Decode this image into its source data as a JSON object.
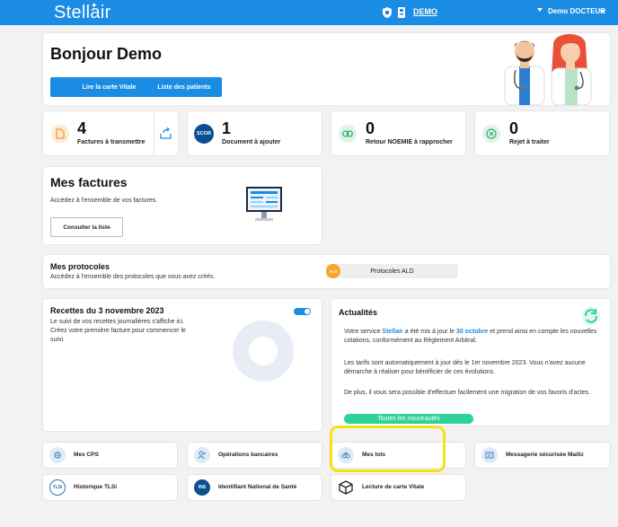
{
  "topbar": {
    "logo": "Stellair",
    "workspace": "DEMO",
    "user": "Demo DOCTEUR"
  },
  "welcome": {
    "greeting": "Bonjour Demo",
    "vitale_button": "Lire la carte Vitale",
    "patients_button": "Liste des patients"
  },
  "stats": [
    {
      "value": "4",
      "label": "Factures à transmettre",
      "icon": "document-icon"
    },
    {
      "value": "1",
      "label": "Document à ajouter",
      "icon": "scor-icon",
      "icon_text": "SCOR"
    },
    {
      "value": "0",
      "label": "Retour NOEMIE à rapprocher",
      "icon": "link-icon"
    },
    {
      "value": "0",
      "label": "Rejet à traiter",
      "icon": "close-circle-icon"
    }
  ],
  "factures": {
    "title": "Mes factures",
    "description": "Accédez à l'ensemble de vos factures.",
    "button": "Consulter la liste"
  },
  "protocoles": {
    "title": "Mes protocoles",
    "description": "Accédez à l'ensemble des protocoles que vous avez créés.",
    "button": "Protocoles ALD",
    "badge": "ALD"
  },
  "recettes": {
    "title": "Recettes du 3 novembre 2023",
    "text": "Le suivi de vos recettes journalières s'affiche ici. Créez votre première facture pour commencer le suivi.",
    "toggle_on": true
  },
  "actualites": {
    "title": "Actualités",
    "para1_before": "Votre service ",
    "para1_brand": "Stellair",
    "para1_mid": " a été mis à jour le ",
    "para1_date": "30 octobre",
    "para1_after": " et prend ainsi en compte les nouvelles cotations, conformément au Règlement Arbitral.",
    "para2": "Les tarifs sont automatiquement à jour dès le 1er novembre 2023. Vous n'avez aucune démarche à réaliser pour bénéficier de ces évolutions.",
    "para3": "De plus, il vous sera possible d'effectuer facilement une migration de vos favoris d'actes.",
    "button": "Toutes les nouveautés"
  },
  "tiles": {
    "mes_cps": "Mes CPS",
    "operations": "Opérations bancaires",
    "mes_lots": "Mes lots",
    "messagerie": "Messagerie sécurisée Mailiz",
    "historique": "Historique TLSi",
    "historique_badge": "TLSi",
    "ins": "Identifiant National de Santé",
    "ins_badge": "INS",
    "lecture": "Lecture de carte Vitale"
  },
  "colors": {
    "primary": "#1b8ce3",
    "accent_green": "#2fd39a",
    "highlight": "#f2e417"
  }
}
